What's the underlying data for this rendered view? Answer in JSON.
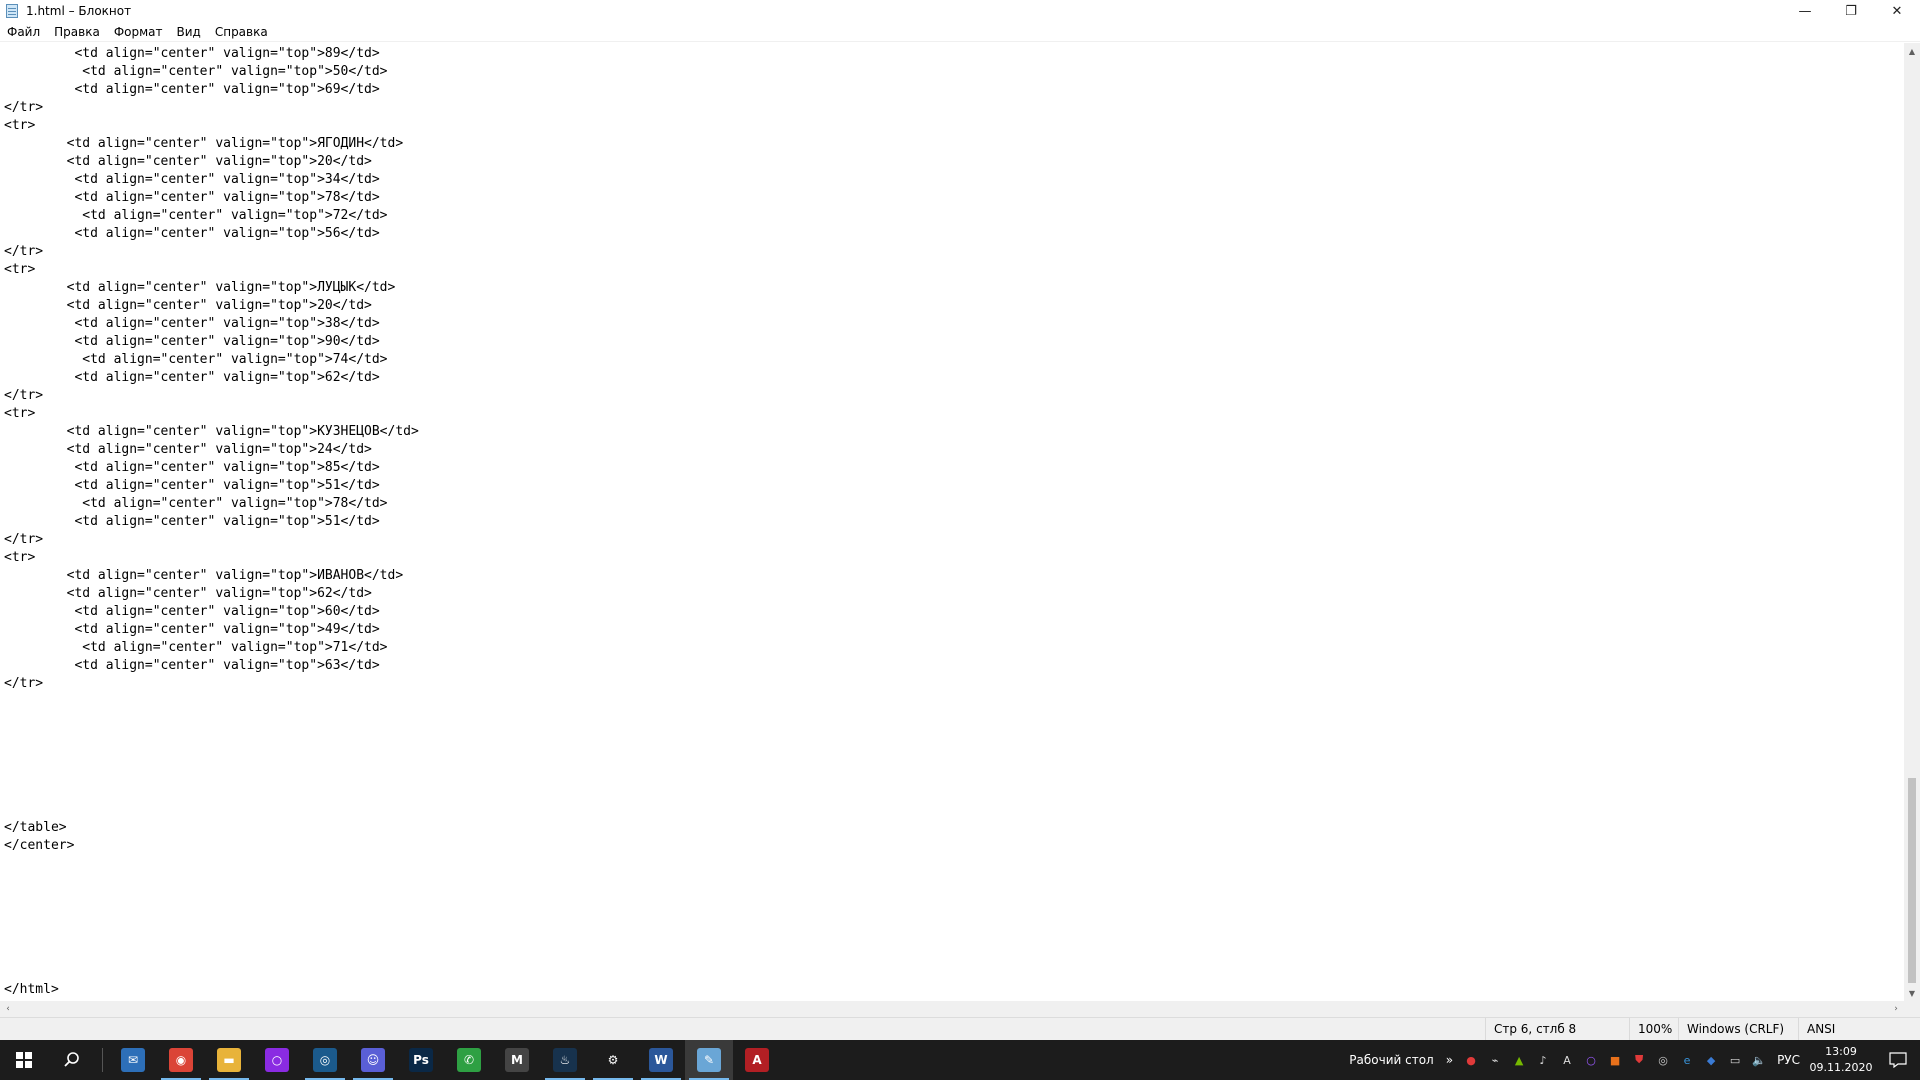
{
  "window": {
    "title": "1.html – Блокнот",
    "minimize_glyph": "—",
    "maximize_glyph": "❐",
    "close_glyph": "✕"
  },
  "menu": {
    "items": [
      "Файл",
      "Правка",
      "Формат",
      "Вид",
      "Справка"
    ]
  },
  "editor": {
    "lines": [
      "         <td align=\"center\" valign=\"top\">89</td>",
      "          <td align=\"center\" valign=\"top\">50</td>",
      "         <td align=\"center\" valign=\"top\">69</td>",
      "</tr>",
      "<tr>",
      "        <td align=\"center\" valign=\"top\">ЯГОДИН</td>",
      "        <td align=\"center\" valign=\"top\">20</td>",
      "         <td align=\"center\" valign=\"top\">34</td>",
      "         <td align=\"center\" valign=\"top\">78</td>",
      "          <td align=\"center\" valign=\"top\">72</td>",
      "         <td align=\"center\" valign=\"top\">56</td>",
      "</tr>",
      "<tr>",
      "        <td align=\"center\" valign=\"top\">ЛУЦЫК</td>",
      "        <td align=\"center\" valign=\"top\">20</td>",
      "         <td align=\"center\" valign=\"top\">38</td>",
      "         <td align=\"center\" valign=\"top\">90</td>",
      "          <td align=\"center\" valign=\"top\">74</td>",
      "         <td align=\"center\" valign=\"top\">62</td>",
      "</tr>",
      "<tr>",
      "        <td align=\"center\" valign=\"top\">КУЗНЕЦОВ</td>",
      "        <td align=\"center\" valign=\"top\">24</td>",
      "         <td align=\"center\" valign=\"top\">85</td>",
      "         <td align=\"center\" valign=\"top\">51</td>",
      "          <td align=\"center\" valign=\"top\">78</td>",
      "         <td align=\"center\" valign=\"top\">51</td>",
      "</tr>",
      "<tr>",
      "        <td align=\"center\" valign=\"top\">ИВАНОВ</td>",
      "        <td align=\"center\" valign=\"top\">62</td>",
      "         <td align=\"center\" valign=\"top\">60</td>",
      "         <td align=\"center\" valign=\"top\">49</td>",
      "          <td align=\"center\" valign=\"top\">71</td>",
      "         <td align=\"center\" valign=\"top\">63</td>",
      "</tr>",
      "",
      "",
      "",
      "",
      "",
      "",
      "",
      "</table>",
      "</center>",
      "",
      "",
      "",
      "",
      "",
      "",
      "",
      "</html>"
    ]
  },
  "status": {
    "position": "Стр 6, стлб 8",
    "zoom": "100%",
    "line_endings": "Windows (CRLF)",
    "encoding": "ANSI"
  },
  "taskbar": {
    "desktop_label": "Рабочий стол",
    "language": "РУС",
    "time": "13:09",
    "date": "09.11.2020",
    "apps": [
      {
        "name": "mail-app-icon",
        "glyph": "✉",
        "color": "#2d6fb8"
      },
      {
        "name": "chrome-icon",
        "glyph": "◉",
        "color": "#db4437"
      },
      {
        "name": "file-explorer-icon",
        "glyph": "▬",
        "color": "#e8b33a"
      },
      {
        "name": "circle-app-icon",
        "glyph": "○",
        "color": "#8a2be2"
      },
      {
        "name": "steam-like-icon",
        "glyph": "◎",
        "color": "#1b5a8c"
      },
      {
        "name": "discord-icon",
        "glyph": "☺",
        "color": "#5a5fd6"
      },
      {
        "name": "photoshop-icon",
        "glyph": "Ps",
        "color": "#0a2846"
      },
      {
        "name": "phone-app-icon",
        "glyph": "✆",
        "color": "#2ea043"
      },
      {
        "name": "m-app-icon",
        "glyph": "M",
        "color": "#444444"
      },
      {
        "name": "steam-icon",
        "glyph": "♨",
        "color": "#17324d"
      },
      {
        "name": "settings-icon",
        "glyph": "⚙",
        "color": "#1c1c1c"
      },
      {
        "name": "word-icon",
        "glyph": "W",
        "color": "#2b579a"
      },
      {
        "name": "notepad-icon",
        "glyph": "✎",
        "color": "#6aa6d6"
      },
      {
        "name": "red-circle-app-icon",
        "glyph": "A",
        "color": "#b21f24"
      }
    ],
    "tray_icons": [
      {
        "name": "record-icon",
        "glyph": "●",
        "color": "#e03a3a"
      },
      {
        "name": "mic-mute-icon",
        "glyph": "⌁",
        "color": "#dddddd"
      },
      {
        "name": "nvidia-icon",
        "glyph": "▲",
        "color": "#76b900"
      },
      {
        "name": "microphone-icon",
        "glyph": "♪",
        "color": "#dddddd"
      },
      {
        "name": "antivirus-icon",
        "glyph": "A",
        "color": "#dddddd"
      },
      {
        "name": "circle-tray-icon",
        "glyph": "○",
        "color": "#9b59ff"
      },
      {
        "name": "orange-tray-icon",
        "glyph": "■",
        "color": "#e8711b"
      },
      {
        "name": "shield-icon",
        "glyph": "⛊",
        "color": "#e03a3a"
      },
      {
        "name": "steam-tray-icon",
        "glyph": "◎",
        "color": "#cccccc"
      },
      {
        "name": "edge-icon",
        "glyph": "e",
        "color": "#3a96dd"
      },
      {
        "name": "dropbox-icon",
        "glyph": "◆",
        "color": "#3a7bd5"
      },
      {
        "name": "network-icon",
        "glyph": "▭",
        "color": "#dddddd"
      },
      {
        "name": "volume-icon",
        "glyph": "🔈",
        "color": "#dddddd"
      }
    ]
  }
}
